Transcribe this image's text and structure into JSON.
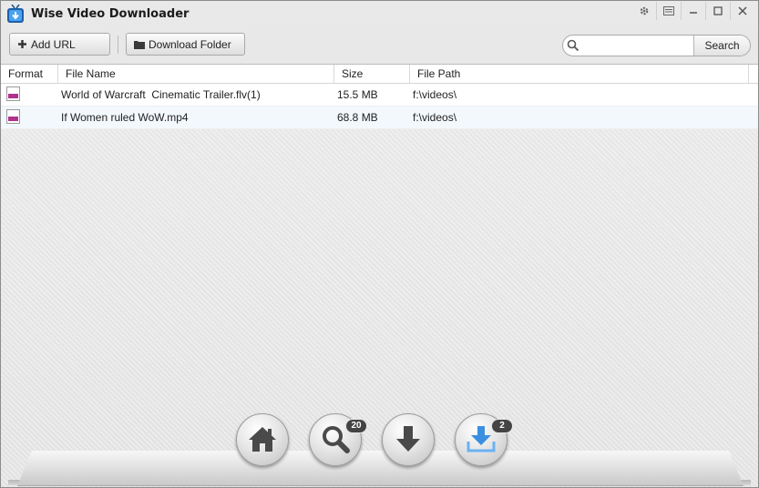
{
  "window": {
    "title": "Wise Video Downloader",
    "controls": [
      "settings-icon",
      "menu-icon",
      "minimize-icon",
      "maximize-icon",
      "close-icon"
    ]
  },
  "toolbar": {
    "add_url_label": "Add URL",
    "download_folder_label": "Download Folder",
    "search_placeholder": "",
    "search_value": "",
    "search_button_label": "Search"
  },
  "table": {
    "columns": [
      "Format",
      "File Name",
      "Size",
      "File Path"
    ],
    "rows": [
      {
        "format_icon": "video-file-icon",
        "name": "World of Warcraft  Cinematic Trailer.flv(1)",
        "size": "15.5 MB",
        "path": "f:\\videos\\"
      },
      {
        "format_icon": "video-file-icon",
        "name": "If Women ruled WoW.mp4",
        "size": "68.8 MB",
        "path": "f:\\videos\\"
      }
    ]
  },
  "nav": {
    "search_count": "20",
    "downloaded_count": "2",
    "icons": [
      "home-icon",
      "search-icon",
      "download-icon",
      "downloaded-icon"
    ]
  },
  "colors": {
    "accent_blue": "#3b8fe0",
    "file_icon_band": "#b0328f",
    "badge_bg": "#444444"
  }
}
